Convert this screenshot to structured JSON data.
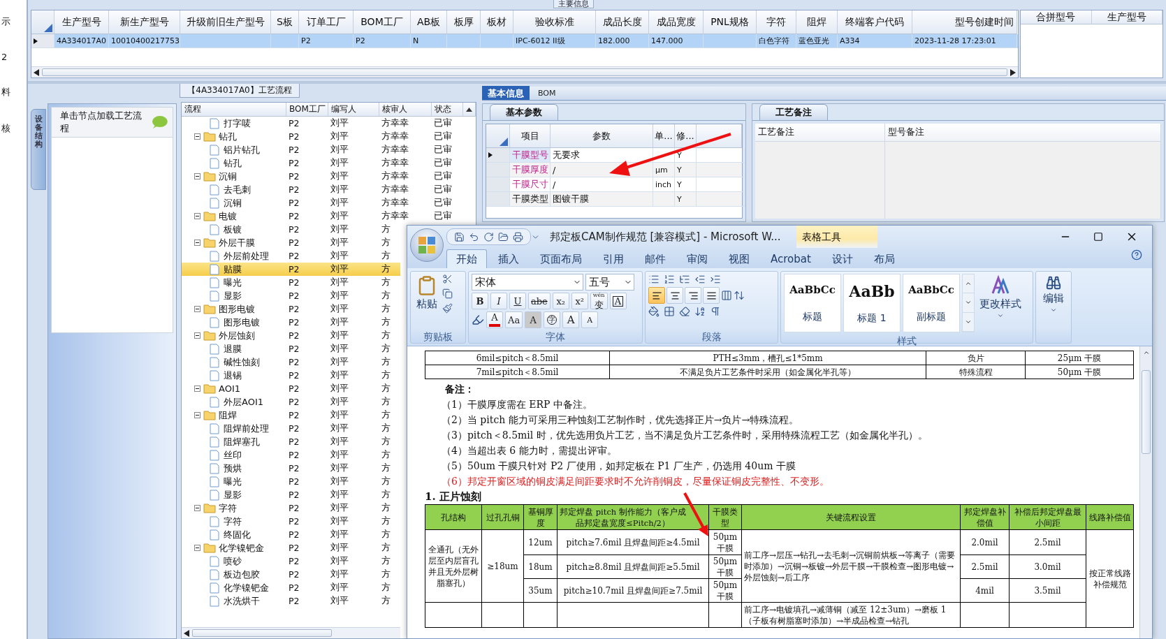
{
  "side_strip": [
    "示",
    "2",
    "料",
    "核"
  ],
  "main_info": {
    "title": "主要信息",
    "columns": [
      "生产型号",
      "新生产型号",
      "升级前旧生产型号",
      "S板",
      "订单工厂",
      "BOM工厂",
      "AB板",
      "板厚",
      "板材",
      "验收标准",
      "成品长度",
      "成品宽度",
      "PNL规格",
      "字符",
      "阻焊",
      "终端客户代码",
      "型号创建时间"
    ],
    "rows": [
      {
        "selected": true,
        "cells": [
          "4A334017A0",
          "10010400217753",
          null,
          null,
          "P2",
          "P2",
          "N",
          null,
          null,
          "IPC-6012 II级",
          "182.000",
          "147.000",
          null,
          "白色字符",
          "蓝色亚光",
          "A334",
          "2023-11-28 17:23:01"
        ]
      }
    ],
    "merge_columns": [
      "合拼型号",
      "生产型号"
    ]
  },
  "process_panel": {
    "title": "【4A334017A0】工艺流程",
    "side_tab": "设备结构",
    "hint": "单击节点加载工艺流程",
    "columns": [
      "流程",
      "BOM工厂",
      "编写人",
      "核审人",
      "状态"
    ],
    "nodes": [
      {
        "label": "打字唛",
        "bom": "P2",
        "author": "刘平",
        "reviewer": "方幸幸",
        "status": "已审",
        "selected": false
      },
      {
        "label": "钻孔",
        "bom": "P2",
        "author": "刘平",
        "reviewer": "方幸幸",
        "status": "已审",
        "selected": false,
        "expanded": true,
        "children": [
          {
            "label": "铝片钻孔",
            "bom": "P2",
            "author": "刘平",
            "reviewer": "方幸幸",
            "status": "已审",
            "selected": false
          },
          {
            "label": "钻孔",
            "bom": "P2",
            "author": "刘平",
            "reviewer": "方幸幸",
            "status": "已审",
            "selected": false
          }
        ]
      },
      {
        "label": "沉铜",
        "bom": "P2",
        "author": "刘平",
        "reviewer": "方幸幸",
        "status": "已审",
        "selected": false,
        "expanded": true,
        "children": [
          {
            "label": "去毛刺",
            "bom": "P2",
            "author": "刘平",
            "reviewer": "方幸幸",
            "status": "已审",
            "selected": false
          },
          {
            "label": "沉铜",
            "bom": "P2",
            "author": "刘平",
            "reviewer": "方幸幸",
            "status": "已审",
            "selected": false
          }
        ]
      },
      {
        "label": "电镀",
        "bom": "P2",
        "author": "刘平",
        "reviewer": "方幸幸",
        "status": "已审",
        "selected": false,
        "expanded": true,
        "children": [
          {
            "label": "板镀",
            "bom": "P2",
            "author": "刘平",
            "reviewer": "方",
            "selected": false
          }
        ]
      },
      {
        "label": "外层干膜",
        "bom": "P2",
        "author": "刘平",
        "reviewer": "方",
        "selected": false,
        "expanded": true,
        "children": [
          {
            "label": "外层前处理",
            "bom": "P2",
            "author": "刘平",
            "reviewer": "方",
            "selected": false
          },
          {
            "label": "贴膜",
            "bom": "P2",
            "author": "刘平",
            "reviewer": "方",
            "selected": true
          },
          {
            "label": "曝光",
            "bom": "P2",
            "author": "刘平",
            "reviewer": "方",
            "selected": false
          },
          {
            "label": "显影",
            "bom": "P2",
            "author": "刘平",
            "reviewer": "方",
            "selected": false
          }
        ]
      },
      {
        "label": "图形电镀",
        "bom": "P2",
        "author": "刘平",
        "reviewer": "方",
        "selected": false,
        "expanded": true,
        "children": [
          {
            "label": "图形电镀",
            "bom": "P2",
            "author": "刘平",
            "reviewer": "方",
            "selected": false
          }
        ]
      },
      {
        "label": "外层蚀刻",
        "bom": "P2",
        "author": "刘平",
        "reviewer": "方",
        "selected": false,
        "expanded": true,
        "children": [
          {
            "label": "退膜",
            "bom": "P2",
            "author": "刘平",
            "reviewer": "方",
            "selected": false
          },
          {
            "label": "碱性蚀刻",
            "bom": "P2",
            "author": "刘平",
            "reviewer": "方",
            "selected": false
          },
          {
            "label": "退锡",
            "bom": "P2",
            "author": "刘平",
            "reviewer": "方",
            "selected": false
          }
        ]
      },
      {
        "label": "AOI1",
        "bom": "P2",
        "author": "刘平",
        "reviewer": "方",
        "selected": false,
        "expanded": true,
        "children": [
          {
            "label": "外层AOI1",
            "bom": "P2",
            "author": "刘平",
            "reviewer": "方",
            "selected": false
          }
        ]
      },
      {
        "label": "阻焊",
        "bom": "P2",
        "author": "刘平",
        "reviewer": "方",
        "selected": false,
        "expanded": true,
        "children": [
          {
            "label": "阻焊前处理",
            "bom": "P2",
            "author": "刘平",
            "reviewer": "方",
            "selected": false
          },
          {
            "label": "阻焊塞孔",
            "bom": "P2",
            "author": "刘平",
            "reviewer": "方",
            "selected": false
          },
          {
            "label": "丝印",
            "bom": "P2",
            "author": "刘平",
            "reviewer": "方",
            "selected": false
          },
          {
            "label": "预烘",
            "bom": "P2",
            "author": "刘平",
            "reviewer": "方",
            "selected": false
          },
          {
            "label": "曝光",
            "bom": "P2",
            "author": "刘平",
            "reviewer": "方",
            "selected": false
          },
          {
            "label": "显影",
            "bom": "P2",
            "author": "刘平",
            "reviewer": "方",
            "selected": false
          }
        ]
      },
      {
        "label": "字符",
        "bom": "P2",
        "author": "刘平",
        "reviewer": "方",
        "selected": false,
        "expanded": true,
        "children": [
          {
            "label": "字符",
            "bom": "P2",
            "author": "刘平",
            "reviewer": "方",
            "selected": false
          },
          {
            "label": "终固化",
            "bom": "P2",
            "author": "刘平",
            "reviewer": "方",
            "selected": false
          }
        ]
      },
      {
        "label": "化学镍钯金",
        "bom": "P2",
        "author": "刘平",
        "reviewer": "方",
        "selected": false,
        "expanded": true,
        "children": [
          {
            "label": "喷砂",
            "bom": "P2",
            "author": "刘平",
            "reviewer": "方",
            "selected": false
          },
          {
            "label": "板边包胶",
            "bom": "P2",
            "author": "刘平",
            "reviewer": "方",
            "selected": false
          },
          {
            "label": "化学镍钯金",
            "bom": "P2",
            "author": "刘平",
            "reviewer": "方",
            "selected": false
          },
          {
            "label": "水洗烘干",
            "bom": "P2",
            "author": "刘平",
            "reviewer": "方",
            "selected": false
          }
        ]
      }
    ]
  },
  "detail_panel": {
    "tabs": [
      {
        "label": "基本信息",
        "selected": true
      },
      {
        "label": "BOM",
        "selected": false
      }
    ],
    "params": {
      "tab": "基本参数",
      "columns": [
        "项目",
        "参数",
        "单...",
        "修..."
      ],
      "rows": [
        {
          "item": "干膜型号",
          "value": "无要求",
          "editable": "Y",
          "required": true,
          "current": true
        },
        {
          "item": "干膜厚度",
          "value": "/",
          "unit": "μm",
          "editable": "Y",
          "required": true,
          "current": false
        },
        {
          "item": "干膜尺寸",
          "value": "/",
          "unit": "inch",
          "editable": "Y",
          "required": true,
          "current": false
        },
        {
          "item": "干膜类型",
          "value": "图镀干膜",
          "editable": "Y",
          "required": false,
          "current": false
        }
      ]
    },
    "remarks": {
      "tab": "工艺备注",
      "columns": [
        "工艺备注",
        "型号备注"
      ]
    }
  },
  "word": {
    "title": "邦定板CAM制作规范 [兼容模式] - Microsoft W...",
    "context_tab": "表格工具",
    "tabs": [
      {
        "label": "开始",
        "selected": true
      },
      {
        "label": "插入",
        "selected": false
      },
      {
        "label": "页面布局",
        "selected": false
      },
      {
        "label": "引用",
        "selected": false
      },
      {
        "label": "邮件",
        "selected": false
      },
      {
        "label": "审阅",
        "selected": false
      },
      {
        "label": "视图",
        "selected": false
      },
      {
        "label": "Acrobat",
        "selected": false
      },
      {
        "label": "设计",
        "selected": false
      },
      {
        "label": "布局",
        "selected": false
      }
    ],
    "clipboard": {
      "paste": "粘贴",
      "label": "剪贴板"
    },
    "font": {
      "name": "宋体",
      "size": "五号",
      "ruby": "wén",
      "phonetic": "变",
      "border": "A",
      "format_buttons": [
        "B",
        "I",
        "U",
        "abe",
        "x₂",
        "x²"
      ],
      "effects": [
        {
          "text": "A",
          "kind": "color"
        },
        {
          "text": "Aa",
          "kind": "case"
        },
        {
          "text": "A",
          "kind": "shade"
        },
        {
          "text": "字",
          "kind": "enclose"
        },
        {
          "text": "A",
          "kind": "grow"
        },
        {
          "text": "A",
          "kind": "shrink"
        }
      ],
      "label": "字体"
    },
    "paragraph": {
      "label": "段落",
      "alignments": [
        {
          "kind": "left",
          "selected": true
        },
        {
          "kind": "center",
          "selected": false
        },
        {
          "kind": "right",
          "selected": false
        },
        {
          "kind": "justify",
          "selected": false
        }
      ]
    },
    "styles": {
      "label": "样式",
      "items": [
        {
          "preview": "AaBbCc",
          "name": "标题",
          "kind": "title"
        },
        {
          "preview": "AaBb",
          "name": "标题 1",
          "kind": "heading"
        },
        {
          "preview": "AaBbCc",
          "name": "副标题",
          "kind": "subtitle"
        }
      ],
      "change": "更改样式"
    },
    "editing": "编辑",
    "document": {
      "top_table": [
        [
          "6mil≤pitch＜8.5mil",
          "PTH≤3mm，槽孔≤1*5mm",
          "负片",
          "25μm 干膜"
        ],
        [
          "7mil≤pitch＜8.5mil",
          "不满足负片工艺条件时采用（如金属化半孔等）",
          "特殊流程",
          "50μm 干膜"
        ]
      ],
      "notes_title": "备注：",
      "notes": [
        {
          "text": "（1）干膜厚度需在 ERP 中备注。",
          "highlight": false
        },
        {
          "text": "（2）当 pitch 能力可采用三种蚀刻工艺制作时，优先选择正片→负片→特殊流程。",
          "highlight": false
        },
        {
          "text": "（3）pitch＜8.5mil 时，优先选用负片工艺，当不满足负片工艺条件时，采用特殊流程工艺（如金属化半孔）。",
          "highlight": false
        },
        {
          "text": "（4）当超出表 6 能力时，需提出评审。",
          "highlight": false
        },
        {
          "text": "（5）50um 干膜只针对 P2 厂使用，如邦定板在 P1 厂生产，仍选用 40um 干膜",
          "highlight": false
        },
        {
          "text": "（6）邦定开窗区域的铜皮满足间距要求时不允许削铜皮，尽量保证铜皮完整性、不变形。",
          "highlight": true
        }
      ],
      "heading": "1. 正片蚀刻",
      "etch_table": {
        "columns": [
          "孔结构",
          "过孔孔铜",
          "基铜厚度",
          "邦定焊盘 pitch 制作能力（客户成品邦定盘宽度≤Pitch/2）",
          "干膜类型",
          "关键流程设置",
          "邦定焊盘补偿值",
          "补偿后邦定焊盘最小间距",
          "线路补偿值"
        ],
        "structure": "全通孔（无外层至内层盲孔并且无外层树脂塞孔）",
        "via_copper": "≥18um",
        "process": "前工序→层压→钻孔→去毛刺→沉铜前烘板→等离子（需要时添加）→沉铜→板镀→外层干膜→干膜检查→图形电镀→外层蚀刻→后工序",
        "rows": [
          {
            "base": "12um",
            "pitch": "pitch≥7.6mil 且焊盘间距≥4.5mil",
            "film": "50μm干膜",
            "comp": "2.0mil",
            "gap": "2.5mil"
          },
          {
            "base": "18um",
            "pitch": "pitch≥8.8mil 且焊盘间距≥5.5mil",
            "film": "50μm干膜",
            "comp": "2.5mil",
            "gap": "3.0mil"
          },
          {
            "base": "35um",
            "pitch": "pitch≥10.7mil 且焊盘间距≥7.5mil",
            "film": "50μm干膜",
            "comp": "4mil",
            "gap": "3.5mil"
          }
        ],
        "line_comp": "按正常线路补偿规范",
        "next_process": "前工序→电镀填孔→减薄铜（减至 12±3um）→磨板 1（子板有树脂塞时添加）→半成品检查→钻孔"
      }
    }
  }
}
